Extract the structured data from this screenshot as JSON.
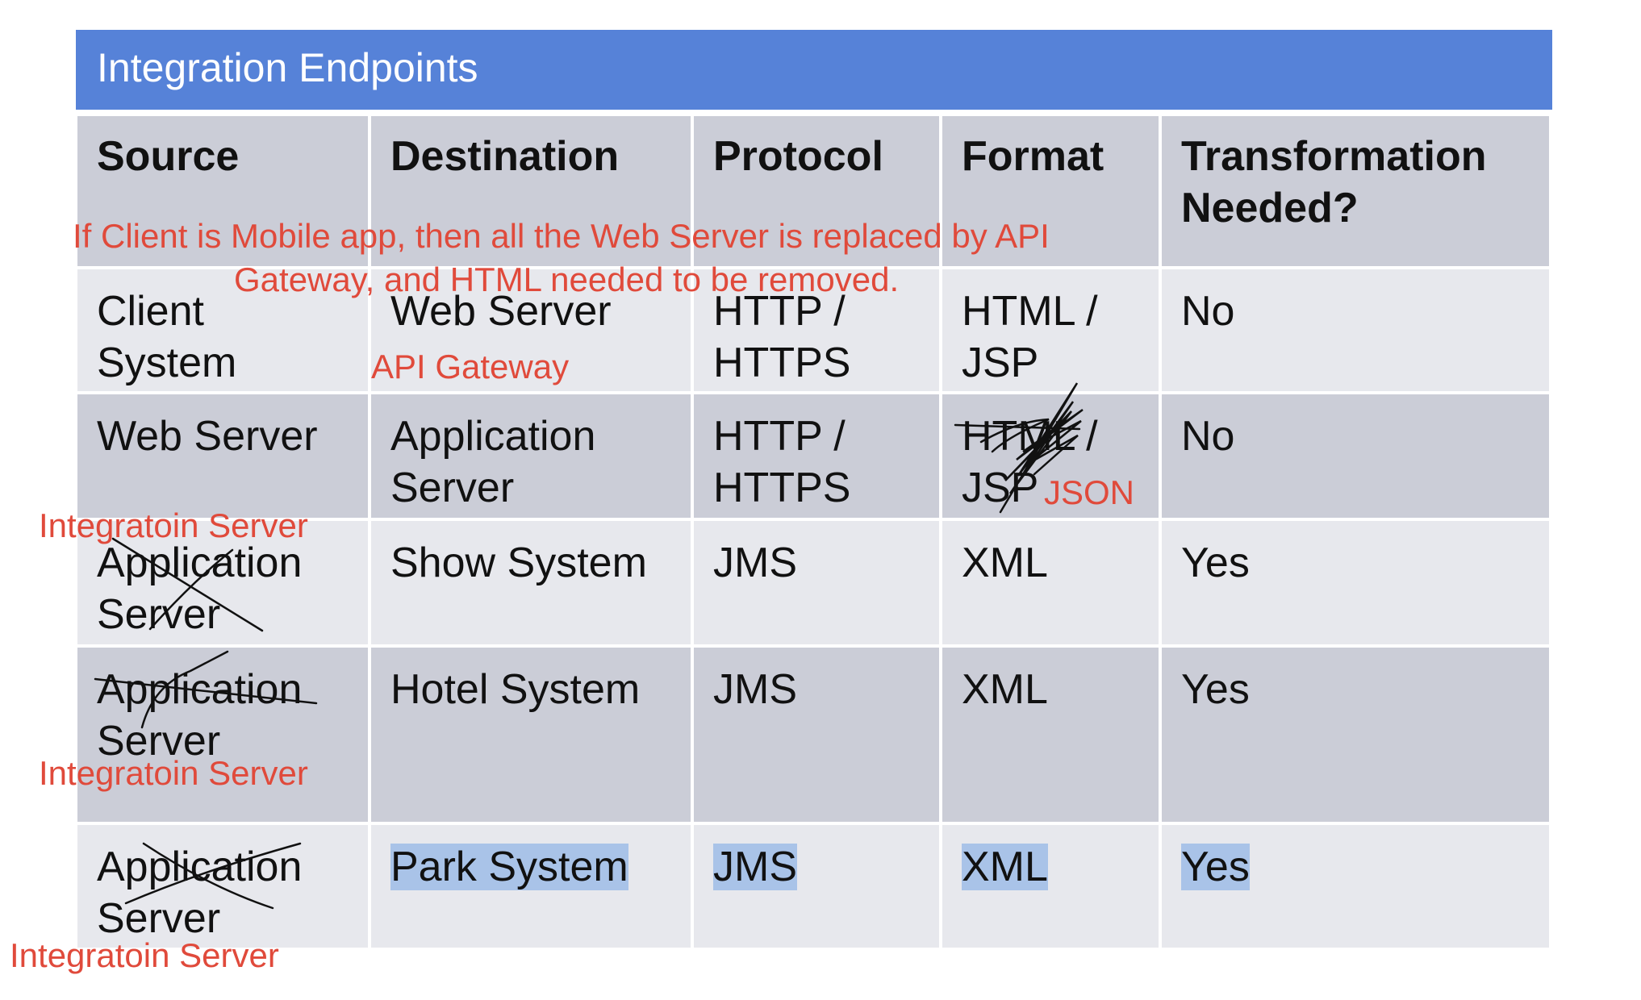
{
  "title": "Integration Endpoints",
  "colors": {
    "title_bar": "#5682d8",
    "header_row": "#cbcdd7",
    "light_row": "#e7e8ed",
    "dark_row": "#cbcdd7",
    "annotation": "#e04a3b",
    "selection": "#a9c3e8"
  },
  "table": {
    "headers": {
      "source": "Source",
      "destination": "Destination",
      "protocol": "Protocol",
      "format": "Format",
      "transformation": "Transformation Needed?"
    },
    "rows": [
      {
        "source": "Client System",
        "destination": "Web Server",
        "protocol": "HTTP / HTTPS",
        "format": "HTML / JSP",
        "transformation": "No"
      },
      {
        "source": "Web Server",
        "destination": "Application Server",
        "protocol": "HTTP / HTTPS",
        "format": "HTML / JSP",
        "transformation": "No"
      },
      {
        "source": "Application Server",
        "destination": "Show System",
        "protocol": "JMS",
        "format": "XML",
        "transformation": "Yes"
      },
      {
        "source": "Application Server",
        "destination": "Hotel  System",
        "protocol": "JMS",
        "format": "XML",
        "transformation": "Yes"
      },
      {
        "source": "Application Server",
        "destination": "Park System",
        "protocol": "JMS",
        "format": "XML",
        "transformation": "Yes"
      }
    ]
  },
  "annotations": {
    "mobile_note_line1": "If Client is Mobile app, then all the Web Server is replaced by API",
    "mobile_note_line2": "Gateway, and HTML needed to be removed.",
    "api_gateway": "API Gateway",
    "json": "JSON",
    "integration_server_row3": "Integratoin Server",
    "integration_server_row4": "Integratoin Server",
    "integration_server_row5": "Integratoin Server"
  }
}
